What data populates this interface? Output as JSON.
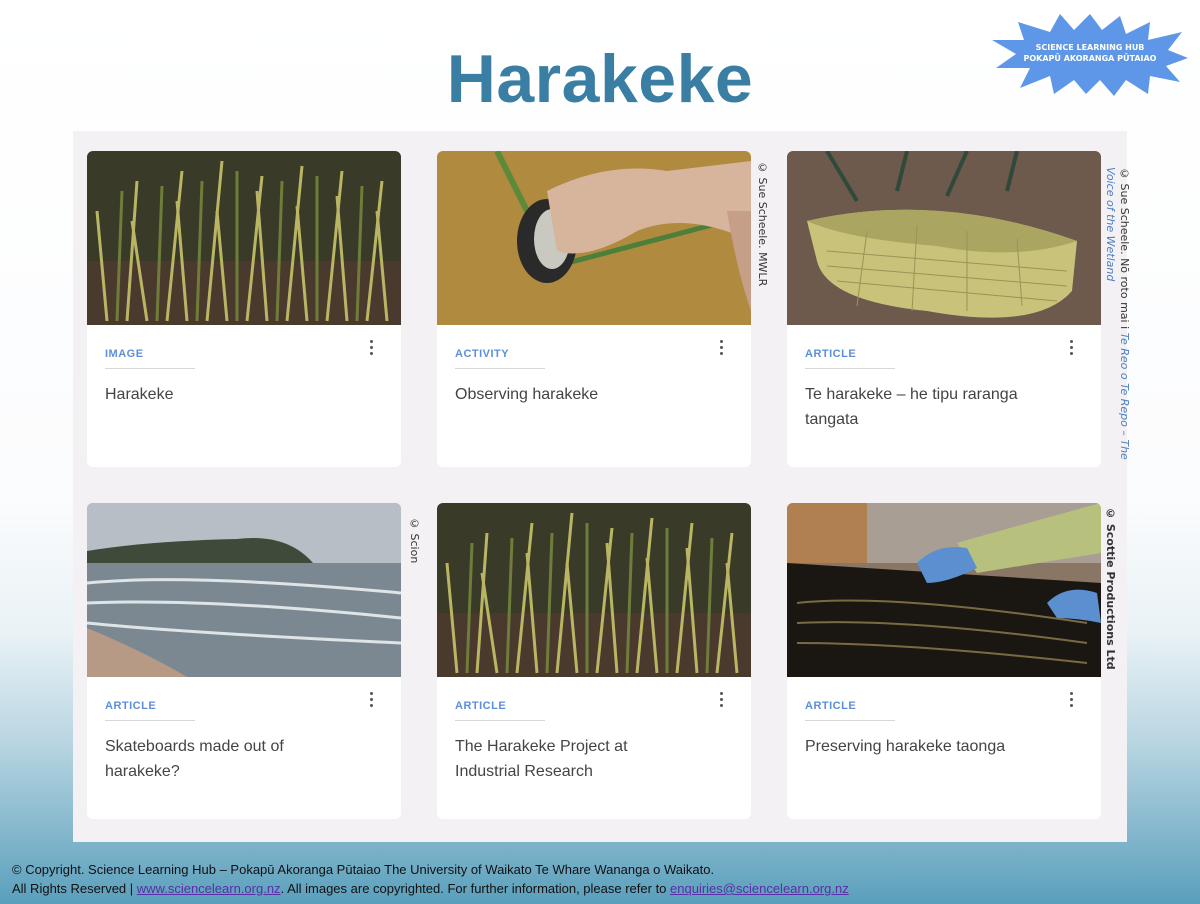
{
  "page": {
    "title": "Harakeke"
  },
  "logo": {
    "line1": "SCIENCE LEARNING HUB",
    "line2": "POKAPŪ AKORANGA PŪTAIAO"
  },
  "cards": [
    {
      "type": "IMAGE",
      "title": "Harakeke",
      "image": "flax-plants"
    },
    {
      "type": "ACTIVITY",
      "title": "Observing harakeke",
      "image": "shell-scraping-flax"
    },
    {
      "type": "ARTICLE",
      "title": "Te harakeke – he tipu raranga tangata",
      "image": "woven-basket"
    },
    {
      "type": "ARTICLE",
      "title": "Skateboards made out of harakeke?",
      "image": "beach-waves"
    },
    {
      "type": "ARTICLE",
      "title": "The Harakeke Project at Industrial Research",
      "image": "flax-plants"
    },
    {
      "type": "ARTICLE",
      "title": "Preserving harakeke taonga",
      "image": "gloved-hands-textile"
    }
  ],
  "credits": {
    "c1": "© Sue Scheele. MWLR",
    "c2_plain": "© Sue Scheele. Nō roto mai i ",
    "c2_italic": "Te Reo o Te Repo – The Voice of the Wetland",
    "c3": "© Scion",
    "c4": "© Scottie Productions Ltd"
  },
  "footer": {
    "line1": "© Copyright. Science Learning Hub – Pokapū Akoranga Pūtaiao The University of Waikato Te Whare Wananga o Waikato.",
    "line2_prefix": "All Rights Reserved | ",
    "site_link": "www.sciencelearn.org.nz",
    "line2_middle": ". All images are copyrighted. For further information, please refer to ",
    "email_link": "enquiries@sciencelearn.org.nz"
  }
}
